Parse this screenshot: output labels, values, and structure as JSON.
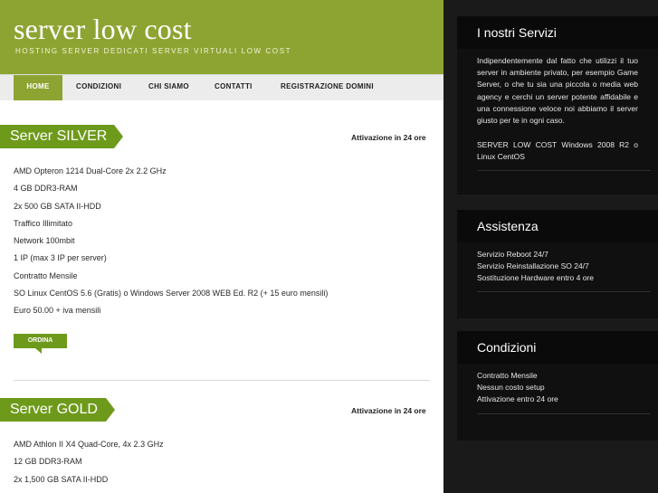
{
  "header": {
    "title": "server low cost",
    "tagline": "HOSTING SERVER DEDICATI SERVER VIRTUALI LOW COST"
  },
  "nav": {
    "items": [
      {
        "label": "HOME",
        "active": true
      },
      {
        "label": "CONDIZIONI",
        "active": false
      },
      {
        "label": "CHI SIAMO",
        "active": false
      },
      {
        "label": "CONTATTI",
        "active": false
      },
      {
        "label": "REGISTRAZIONE DOMINI",
        "active": false
      }
    ]
  },
  "silver": {
    "title": "Server SILVER",
    "activation": "Attivazione in 24 ore",
    "specs": [
      "AMD Opteron 1214 Dual-Core 2x 2.2 GHz",
      "4 GB DDR3-RAM",
      "2x 500 GB SATA II-HDD",
      "Traffico Illimitato",
      "Network 100mbit",
      "1 IP (max 3 IP per server)",
      "Contratto Mensile",
      "SO Linux CentOS 5.6 (Gratis) o Windows Server 2008 WEB Ed. R2 (+ 15 euro mensili)",
      "Euro 50.00 + iva mensili"
    ],
    "order_label": "ORDINA"
  },
  "gold": {
    "title": "Server GOLD",
    "activation": "Attivazione in 24 ore",
    "specs": [
      "AMD Athlon II X4 Quad-Core, 4x 2.3 GHz",
      "12 GB DDR3-RAM",
      "2x 1,500 GB SATA II-HDD"
    ]
  },
  "sidebar": {
    "services": {
      "title": "I nostri Servizi",
      "text": "Indipendentemente dal fatto che utilizzi il tuo server in ambiente privato, per esempio Game Server, o che tu sia una piccola o media web agency e cerchi un server potente affidabile e una connessione veloce noi abbiamo il server giusto per te in ogni caso.",
      "text2": "SERVER LOW COST Windows 2008 R2 o Linux CentOS"
    },
    "assistance": {
      "title": "Assistenza",
      "lines": [
        "Servizio Reboot 24/7",
        "Servizio Reinstallazione SO 24/7",
        "Sostituzione Hardware entro 4 ore"
      ]
    },
    "conditions": {
      "title": "Condizioni",
      "lines": [
        "Contratto Mensile",
        "Nessun costo setup",
        "Attivazione entro 24 ore"
      ]
    }
  },
  "colors": {
    "brand_green": "#8ea432",
    "ribbon_green": "#6e9a1c",
    "sidebar_bg": "#1a1a1a"
  }
}
